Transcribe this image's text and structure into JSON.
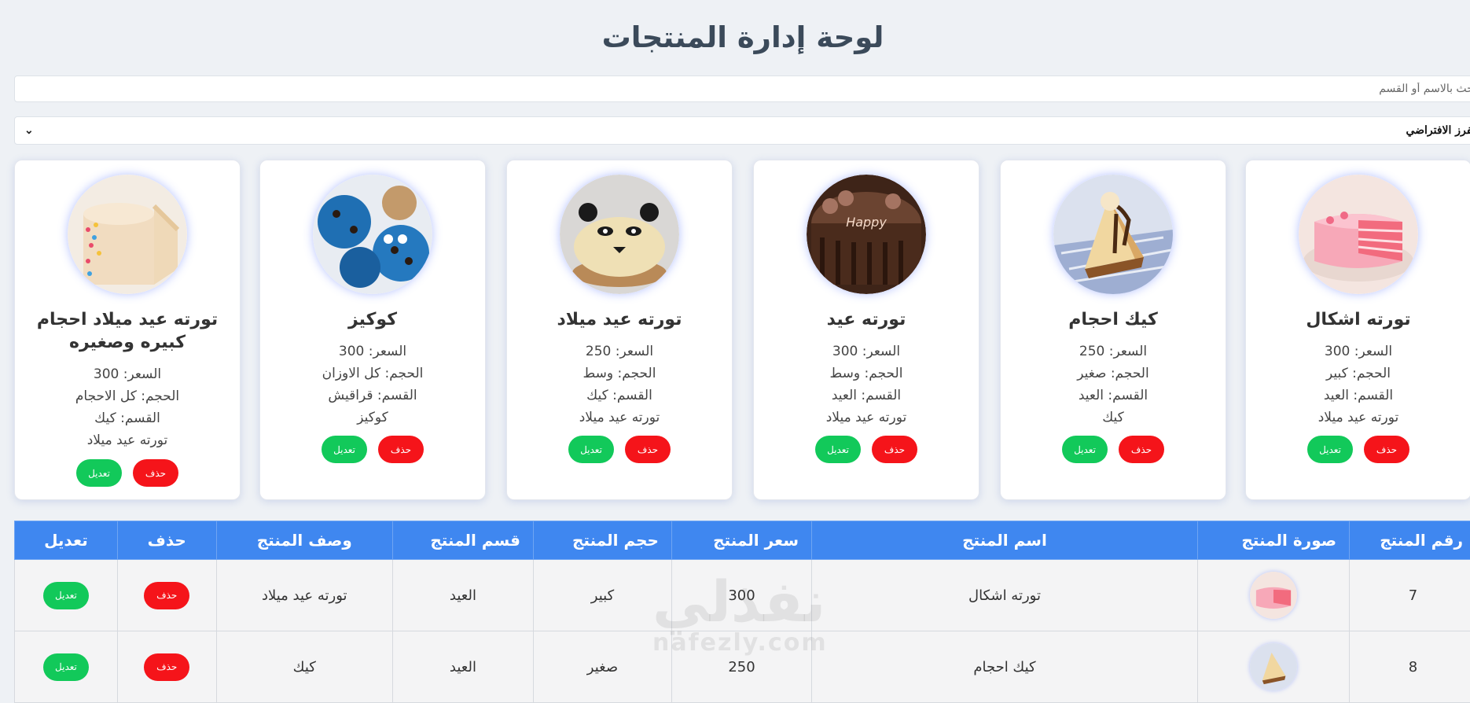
{
  "page": {
    "title": "لوحة إدارة المنتجات"
  },
  "search": {
    "placeholder": "ابحث بالاسم أو القسم"
  },
  "sort": {
    "selected": "الفرز الافتراضي"
  },
  "labels": {
    "price": "السعر",
    "size": "الحجم",
    "category": "القسم",
    "delete": "حذف",
    "edit": "تعديل"
  },
  "cards": [
    {
      "name": "تورته اشكال",
      "price": "السعر: 300",
      "size": "الحجم: كبير",
      "category": "القسم: العيد",
      "desc": "تورته عيد ميلاد",
      "image": "pink-cake"
    },
    {
      "name": "كيك احجام",
      "price": "السعر: 250",
      "size": "الحجم: صغير",
      "category": "القسم: العيد",
      "desc": "كيك",
      "image": "cheesecake-slice"
    },
    {
      "name": "تورته عيد",
      "price": "السعر: 300",
      "size": "الحجم: وسط",
      "category": "القسم: العيد",
      "desc": "تورته عيد ميلاد",
      "image": "chocolate-birthday-cake"
    },
    {
      "name": "تورته عيد ميلاد",
      "price": "السعر: 250",
      "size": "الحجم: وسط",
      "category": "القسم: كيك",
      "desc": "تورته عيد ميلاد",
      "image": "panda-cake"
    },
    {
      "name": "كوكيز",
      "price": "السعر: 300",
      "size": "الحجم: كل الاوزان",
      "category": "القسم: قراقيش",
      "desc": "كوكيز",
      "image": "blue-cookies"
    },
    {
      "name": "تورته عيد ميلاد احجام كبيره وصغيره",
      "price": "السعر: 300",
      "size": "الحجم: كل الاحجام",
      "category": "القسم: كيك",
      "desc": "تورته عيد ميلاد",
      "image": "sprinkle-cake"
    }
  ],
  "table": {
    "headers": [
      "رقم المنتج",
      "صورة المنتج",
      "اسم المنتج",
      "سعر المنتج",
      "حجم المنتج",
      "قسم المنتج",
      "وصف المنتج",
      "حذف",
      "تعديل"
    ],
    "rows": [
      {
        "id": "7",
        "image": "pink-cake",
        "name": "تورته اشكال",
        "price": "300",
        "size": "كبير",
        "category": "العيد",
        "desc": "تورته عيد ميلاد"
      },
      {
        "id": "8",
        "image": "cheesecake-slice",
        "name": "كيك احجام",
        "price": "250",
        "size": "صغير",
        "category": "العيد",
        "desc": "كيك"
      }
    ]
  },
  "watermark": {
    "arabic": "نفذلي",
    "latin": "nafezly.com"
  },
  "colors": {
    "header_blue": "#3f87f0",
    "delete_red": "#f5141a",
    "edit_green": "#12c95a"
  }
}
